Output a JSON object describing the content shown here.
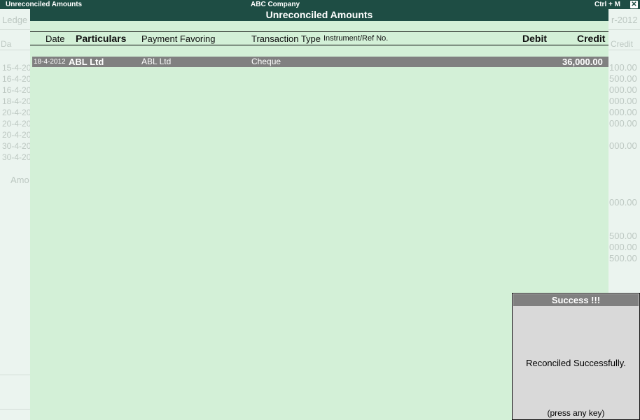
{
  "window": {
    "left_title": "Unreconciled Amounts",
    "company": "ABC Company",
    "shortcut": "Ctrl + M",
    "close_glyph": "✕"
  },
  "background": {
    "left_header": "Ledge",
    "left_col_header": "Da",
    "right_header": "r-2012",
    "right_col_header": "Credit",
    "dates": [
      "15-4-20",
      "16-4-20",
      "16-4-20",
      "18-4-20",
      "20-4-20",
      "20-4-20",
      "20-4-20",
      "30-4-20",
      "30-4-20"
    ],
    "amount_label": "Amo",
    "right_values": [
      "100.00",
      "500.00",
      "000.00",
      "000.00",
      "000.00",
      "000.00",
      "000.00",
      "000.00",
      "500.00",
      "000.00",
      "500.00"
    ]
  },
  "panel": {
    "title": "Unreconciled Amounts",
    "columns": {
      "date": "Date",
      "particulars": "Particulars",
      "payment_favoring": "Payment Favoring",
      "transaction_type": "Transaction Type",
      "instrument": "Instrument/Ref No.",
      "debit": "Debit",
      "credit": "Credit"
    },
    "rows": [
      {
        "date": "18-4-2012",
        "particulars": "ABL Ltd",
        "payment_favoring": "ABL Ltd",
        "transaction_type": "Cheque",
        "instrument": "",
        "debit": "",
        "credit": "36,000.00"
      }
    ]
  },
  "dialog": {
    "title": "Success !!!",
    "message": "Reconciled Successfully.",
    "hint": "(press any key)"
  }
}
